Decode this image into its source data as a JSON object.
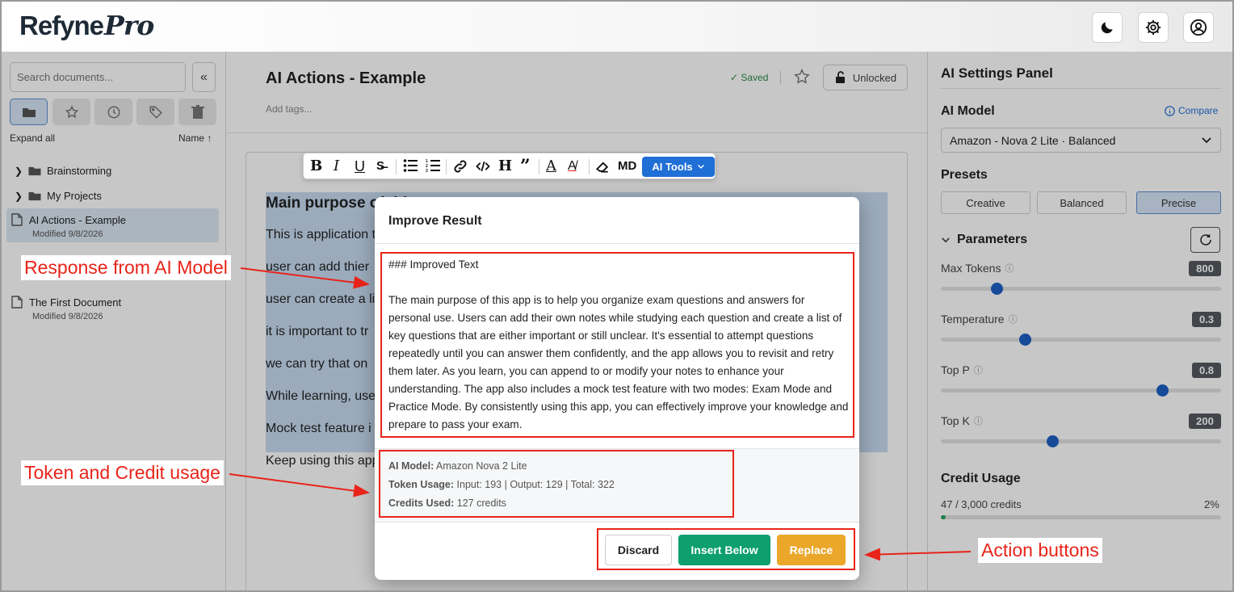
{
  "header": {
    "logo_main": "Refyne",
    "logo_script": "Pro"
  },
  "sidebar": {
    "search_placeholder": "Search documents...",
    "collapse_label": "«",
    "expand_all": "Expand all",
    "sort_label": "Name ↑",
    "folders": [
      {
        "label": "Brainstorming"
      },
      {
        "label": "My Projects"
      }
    ],
    "documents": [
      {
        "title": "AI Actions - Example",
        "modified": "Modified 9/8/2026"
      },
      {
        "title": "The First Document",
        "modified": "Modified 9/8/2026"
      }
    ]
  },
  "document": {
    "title": "AI Actions - Example",
    "saved": "✓ Saved",
    "lock_label": "Unlocked",
    "tags_placeholder": "Add tags...",
    "lines": [
      "Main purpose of this",
      "This is application t",
      "user can add thier",
      "user can create a li",
      "it is important to tr",
      "we can try that on",
      "While learning, use",
      "Mock test feature i",
      "Keep using this app"
    ]
  },
  "toolbar": {
    "ai_tools_label": "AI Tools",
    "md_label": "MD"
  },
  "modal": {
    "title": "Improve Result",
    "heading": "### Improved Text",
    "body": "The main purpose of this app is to help you organize exam questions and answers for personal use. Users can add their own notes while studying each question and create a list of key questions that are either important or still unclear. It's essential to attempt questions repeatedly until you can answer them confidently, and the app allows you to revisit and retry them later. As you learn, you can append to or modify your notes to enhance your understanding. The app also includes a mock test feature with two modes: Exam Mode and Practice Mode. By consistently using this app, you can effectively improve your knowledge and prepare to pass your exam.",
    "model_label": "AI Model:",
    "model_value": "Amazon Nova 2 Lite",
    "token_label": "Token Usage:",
    "token_value": "Input: 193 | Output: 129 | Total: 322",
    "credits_label": "Credits Used:",
    "credits_value": "127 credits",
    "discard": "Discard",
    "insert_below": "Insert Below",
    "replace": "Replace"
  },
  "settings": {
    "title": "AI Settings Panel",
    "model_heading": "AI Model",
    "compare": "Compare",
    "model_selected": "Amazon - Nova 2 Lite · Balanced",
    "presets_heading": "Presets",
    "presets": [
      "Creative",
      "Balanced",
      "Precise"
    ],
    "active_preset": "Precise",
    "parameters_heading": "Parameters",
    "params": [
      {
        "label": "Max Tokens",
        "value": "800",
        "level": 0.2
      },
      {
        "label": "Temperature",
        "value": "0.3",
        "level": 0.3
      },
      {
        "label": "Top P",
        "value": "0.8",
        "level": 0.79
      },
      {
        "label": "Top K",
        "value": "200",
        "level": 0.4
      }
    ],
    "credit_heading": "Credit Usage",
    "credit_text": "47 / 3,000 credits",
    "credit_pct": "2%",
    "credit_fraction": 0.016
  },
  "annotations": {
    "response": "Response from AI Model",
    "usage": "Token and Credit usage",
    "actions": "Action buttons"
  },
  "colors": {
    "accent": "#1f6fd6",
    "insert": "#0d9f6e",
    "replace": "#eaa72a",
    "annotation": "#e8241a"
  }
}
